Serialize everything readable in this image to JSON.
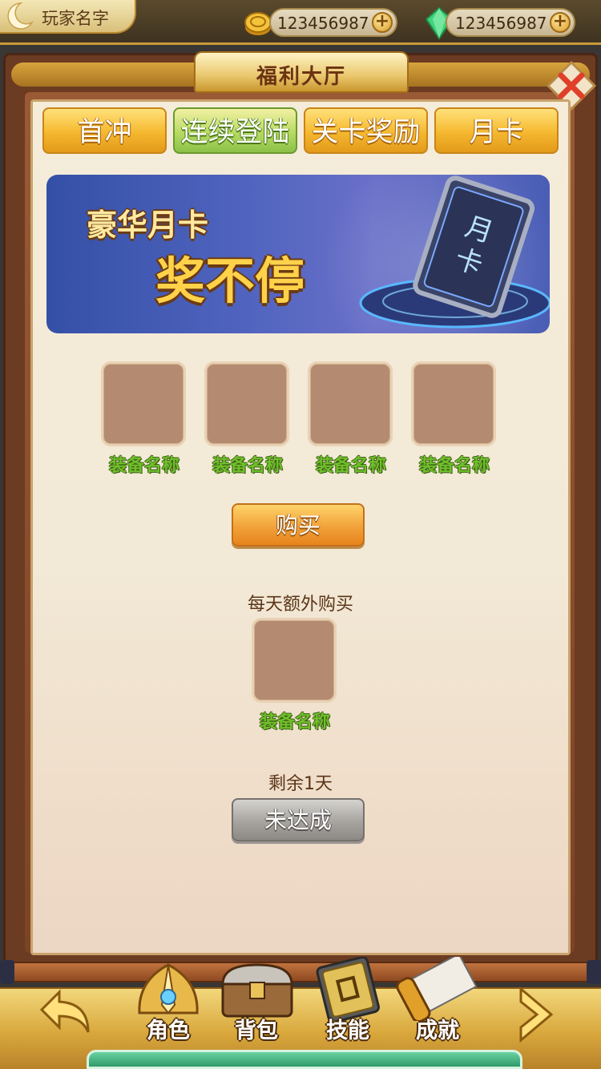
{
  "header": {
    "player_name": "玩家名字",
    "gold_amount": "123456987",
    "gem_amount": "123456987",
    "plus_label": "+"
  },
  "window": {
    "title": "福利大厅"
  },
  "tabs": [
    {
      "label": "首冲",
      "style": "yellow"
    },
    {
      "label": "连续登陆",
      "style": "green"
    },
    {
      "label": "关卡奖励",
      "style": "yellow"
    },
    {
      "label": "月卡",
      "style": "yellow",
      "selected": true
    }
  ],
  "banner": {
    "line1": "豪华月卡",
    "line2": "奖不停",
    "card_text": "月卡"
  },
  "rewards": [
    {
      "name": "装备名称"
    },
    {
      "name": "装备名称"
    },
    {
      "name": "装备名称"
    },
    {
      "name": "装备名称"
    }
  ],
  "buy_button": "购买",
  "extra": {
    "label": "每天额外购买",
    "item_name": "装备名称"
  },
  "remaining": "剩余1天",
  "status_button": "未达成",
  "bottom_nav": [
    {
      "label": "角色",
      "icon": "helmet-icon"
    },
    {
      "label": "背包",
      "icon": "chest-icon"
    },
    {
      "label": "技能",
      "icon": "skill-book-icon"
    },
    {
      "label": "成就",
      "icon": "scroll-icon"
    }
  ],
  "colors": {
    "panel_bg": "#f5ecda",
    "frame": "#6b3b22",
    "tab_yellow": "#f5b82f",
    "tab_green": "#b7da62",
    "item_name_green": "#6fbf2b",
    "slot": "#b48a70"
  }
}
